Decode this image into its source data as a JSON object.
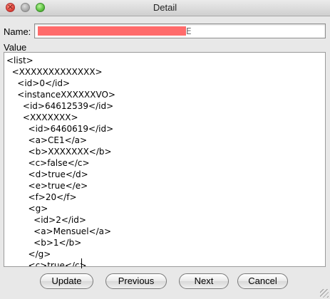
{
  "window": {
    "title": "Detail"
  },
  "name": {
    "label": "Name:",
    "value": "E"
  },
  "value": {
    "label": "Value",
    "lines": [
      "<list>",
      "  <XXXXXXXXXXXXX>",
      "    <id>0</id>",
      "    <instanceXXXXXXVO>",
      "      <id>64612539</id>",
      "      <XXXXXXX>",
      "        <id>6460619</id>",
      "        <a>CE1</a>",
      "        <b>XXXXXXX</b>",
      "        <c>false</c>",
      "        <d>true</d>",
      "        <e>true</e>",
      "        <f>20</f>",
      "        <g>",
      "          <id>2</id>",
      "          <a>Mensuel</a>",
      "          <b>1</b>",
      "        </g>",
      "        <c>true</c>"
    ]
  },
  "buttons": {
    "update": "Update",
    "previous": "Previous",
    "next": "Next",
    "cancel": "Cancel"
  }
}
